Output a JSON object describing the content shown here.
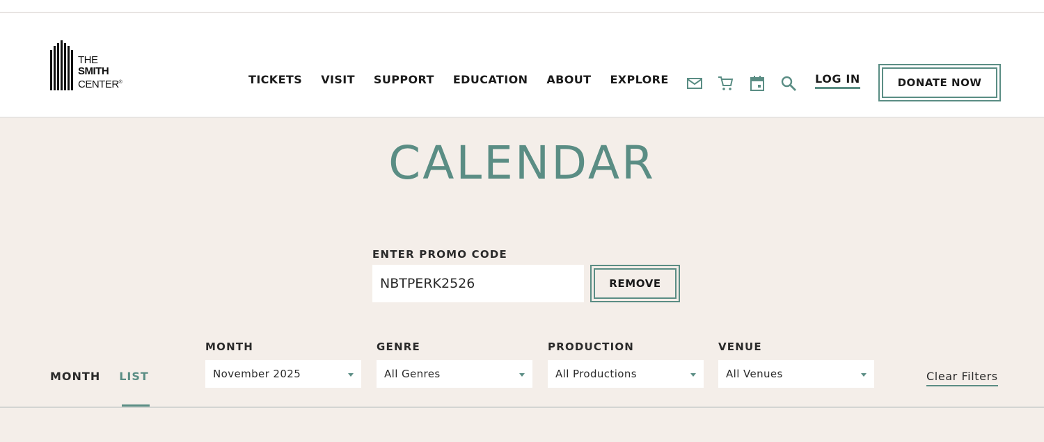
{
  "logo": {
    "line1": "THE",
    "line2": "SMITH",
    "line3": "CENTER",
    "mark": "®"
  },
  "nav": {
    "items": [
      {
        "label": "TICKETS"
      },
      {
        "label": "VISIT"
      },
      {
        "label": "SUPPORT"
      },
      {
        "label": "EDUCATION"
      },
      {
        "label": "ABOUT"
      },
      {
        "label": "EXPLORE"
      }
    ],
    "icons": [
      "mail-icon",
      "cart-icon",
      "calendar-icon",
      "search-icon"
    ],
    "login_label": "LOG IN",
    "donate_label": "DONATE NOW"
  },
  "page": {
    "title": "CALENDAR"
  },
  "promo": {
    "label": "ENTER PROMO CODE",
    "value": "NBTPERK2526",
    "remove_label": "REMOVE"
  },
  "view_toggle": {
    "month_label": "MONTH",
    "list_label": "LIST",
    "active": "LIST"
  },
  "filters": [
    {
      "label": "MONTH",
      "selected": "November 2025"
    },
    {
      "label": "GENRE",
      "selected": "All Genres"
    },
    {
      "label": "PRODUCTION",
      "selected": "All Productions"
    },
    {
      "label": "VENUE",
      "selected": "All Venues"
    }
  ],
  "clear_filters_label": "Clear Filters",
  "colors": {
    "accent": "#5a8d84",
    "background": "#f4eee9",
    "text": "#1a1a1a"
  }
}
